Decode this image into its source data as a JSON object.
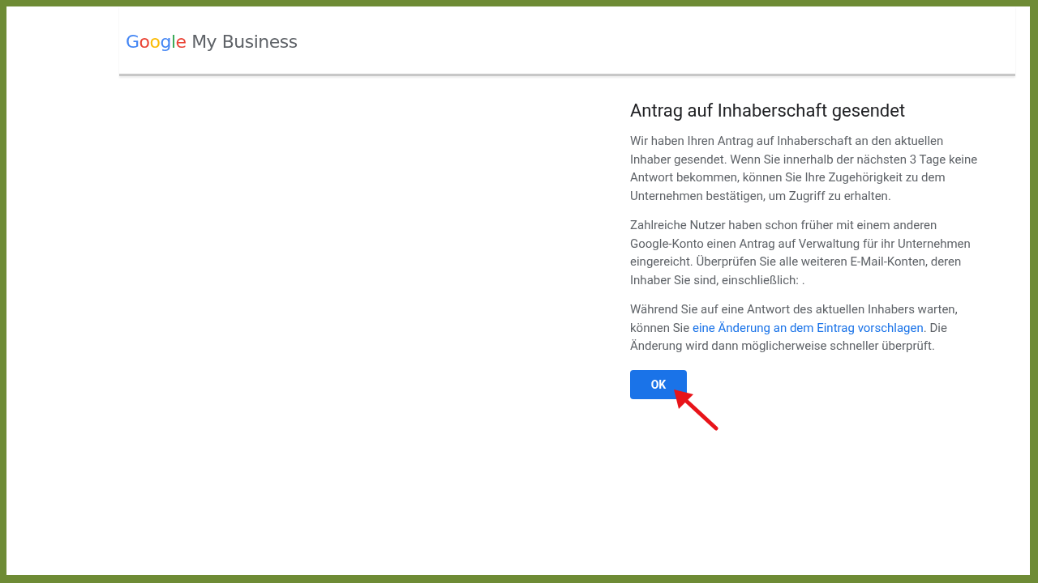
{
  "header": {
    "logo": [
      {
        "text": "G",
        "color": "#4285f4"
      },
      {
        "text": "o",
        "color": "#ea4335"
      },
      {
        "text": "o",
        "color": "#fbbc05"
      },
      {
        "text": "g",
        "color": "#4285f4"
      },
      {
        "text": "l",
        "color": "#34a853"
      },
      {
        "text": "e",
        "color": "#ea4335"
      }
    ],
    "product": "My Business"
  },
  "dialog": {
    "title": "Antrag auf Inhaberschaft gesendet",
    "paragraphs": [
      {
        "parts": [
          {
            "kind": "text",
            "text": "Wir haben Ihren Antrag auf Inhaberschaft an den aktuellen Inhaber gesendet. Wenn Sie innerhalb der nächsten 3 Tage keine Antwort bekommen, können Sie Ihre Zugehörigkeit zu dem Unternehmen bestätigen, um Zugriff zu erhalten."
          }
        ]
      },
      {
        "parts": [
          {
            "kind": "text",
            "text": "Zahlreiche Nutzer haben schon früher mit einem anderen Google-Konto einen Antrag auf Verwaltung für ihr Unternehmen eingereicht. Überprüfen Sie alle weiteren E-Mail-Konten, deren Inhaber Sie sind, einschließlich: ."
          }
        ]
      },
      {
        "parts": [
          {
            "kind": "text",
            "text": "Während Sie auf eine Antwort des aktuellen Inhabers warten, können Sie "
          },
          {
            "kind": "link",
            "text": "eine Änderung an dem Eintrag vorschlagen"
          },
          {
            "kind": "text",
            "text": ". Die Änderung wird dann möglicherweise schneller überprüft."
          }
        ]
      }
    ],
    "button": "OK"
  }
}
